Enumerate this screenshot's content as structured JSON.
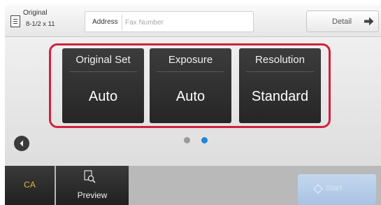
{
  "header": {
    "original_label": "Original",
    "original_size": "8-1/2 x 11",
    "address_label": "Address",
    "address_placeholder": "Fax Number",
    "detail_label": "Detail"
  },
  "settings": [
    {
      "title": "Original Set",
      "value": "Auto"
    },
    {
      "title": "Exposure",
      "value": "Auto"
    },
    {
      "title": "Resolution",
      "value": "Standard"
    }
  ],
  "pagination": {
    "current": 2,
    "total": 2
  },
  "footer": {
    "ca_label": "CA",
    "preview_label": "Preview",
    "start_label": "Start"
  },
  "icons": {
    "original": "document-icon",
    "detail": "arrow-right-icon",
    "back": "chevron-left-icon",
    "preview": "magnifier-document-icon",
    "start": "start-diamond-icon"
  },
  "colors": {
    "highlight_frame": "#d3203c",
    "active_dot": "#1f86d9",
    "ca_text": "#e4b53a",
    "start_button": "#b6cde9"
  }
}
